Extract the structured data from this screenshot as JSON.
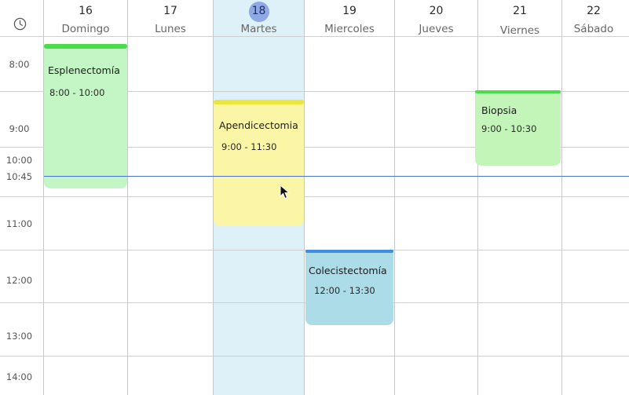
{
  "calendar": {
    "days": [
      {
        "num": "16",
        "name": "Domingo"
      },
      {
        "num": "17",
        "name": "Lunes"
      },
      {
        "num": "18",
        "name": "Martes",
        "today": true
      },
      {
        "num": "19",
        "name": "Miercoles"
      },
      {
        "num": "20",
        "name": "Jueves"
      },
      {
        "num": "21",
        "name": "Viernes"
      },
      {
        "num": "22",
        "name": "Sábado"
      }
    ],
    "times": [
      "8:00",
      "9:00",
      "10:00",
      "10:45",
      "11:00",
      "12:00",
      "13:00",
      "14:00"
    ],
    "current_time": "10:45"
  },
  "events": [
    {
      "title": "Esplenectomía",
      "time": "8:00 - 10:00",
      "day": "Domingo",
      "color": "#c4f5c4",
      "bar_color": "#4bdc4b"
    },
    {
      "title": "Apendicectomia",
      "time": "9:00 - 11:30",
      "day": "Martes",
      "color": "#fbf6a6",
      "bar_color": "#ece53c"
    },
    {
      "title": "Biopsia",
      "time": "9:00 - 10:30",
      "day": "Viernes",
      "color": "#c4f5b8",
      "bar_color": "#4bdc4b"
    },
    {
      "title": "Colecistectomía",
      "time": "12:00 - 13:30",
      "day": "Miercoles",
      "color": "#abdce8",
      "bar_color": "#3f8ee0"
    }
  ],
  "colors": {
    "today_column": "#def1f9",
    "today_circle": "#8fa8e6",
    "now_line": "#4a72d8"
  }
}
